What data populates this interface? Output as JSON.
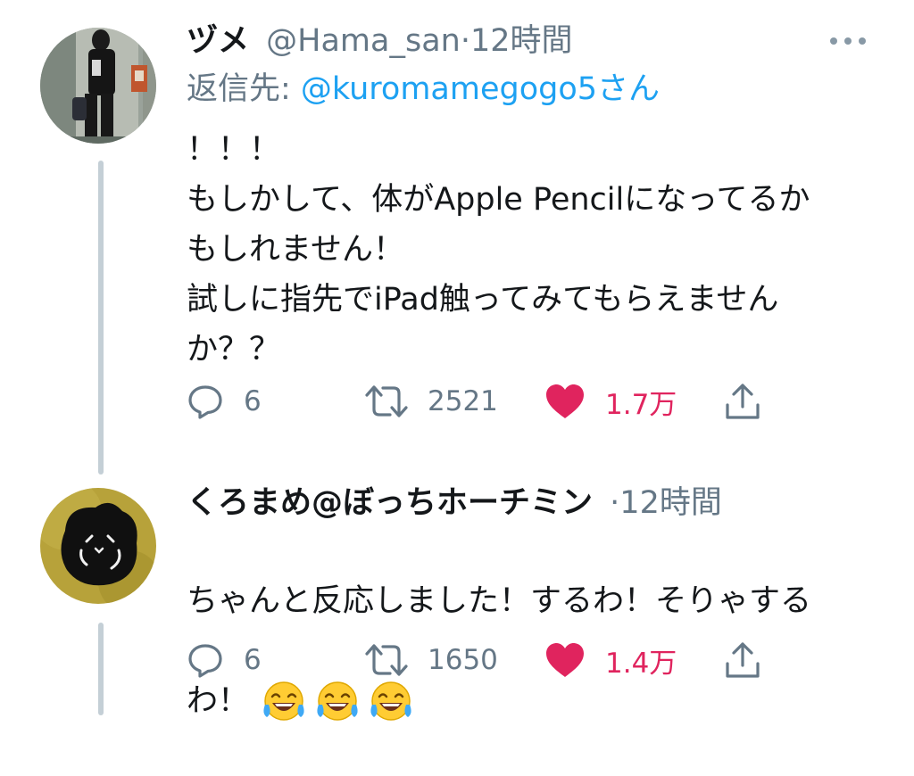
{
  "tweets": [
    {
      "display_name": "ヅメ",
      "handle": "@Hama_san",
      "separator": "·",
      "time": "12時間",
      "reply_to_prefix": "返信先: ",
      "reply_to_handle": "@kuromamegogo5さん",
      "text": "！！！\nもしかして、体がApple Pencilになってるか\nもしれません！\n試しに指先でiPad触ってみてもらえません\nか？？",
      "replies": "6",
      "retweets": "2521",
      "likes": "1.7万"
    },
    {
      "display_name": "くろまめ@ぼっちホーチミン",
      "separator": "·",
      "time": "12時間",
      "text_line1": "ちゃんと反応しました！するわ！そりゃする",
      "text_line2": "わ！",
      "emojis": [
        "😂",
        "😂",
        "😂"
      ],
      "replies": "6",
      "retweets": "1650",
      "likes": "1.4万"
    }
  ],
  "icons": {
    "reply": "reply-icon",
    "retweet": "retweet-icon",
    "like": "heart-icon",
    "share": "share-icon",
    "more": "more-icon"
  },
  "colors": {
    "like_active": "#e0245e",
    "link": "#1da1f2",
    "secondary_text": "#657786",
    "thread_line": "#c4cfd6"
  }
}
